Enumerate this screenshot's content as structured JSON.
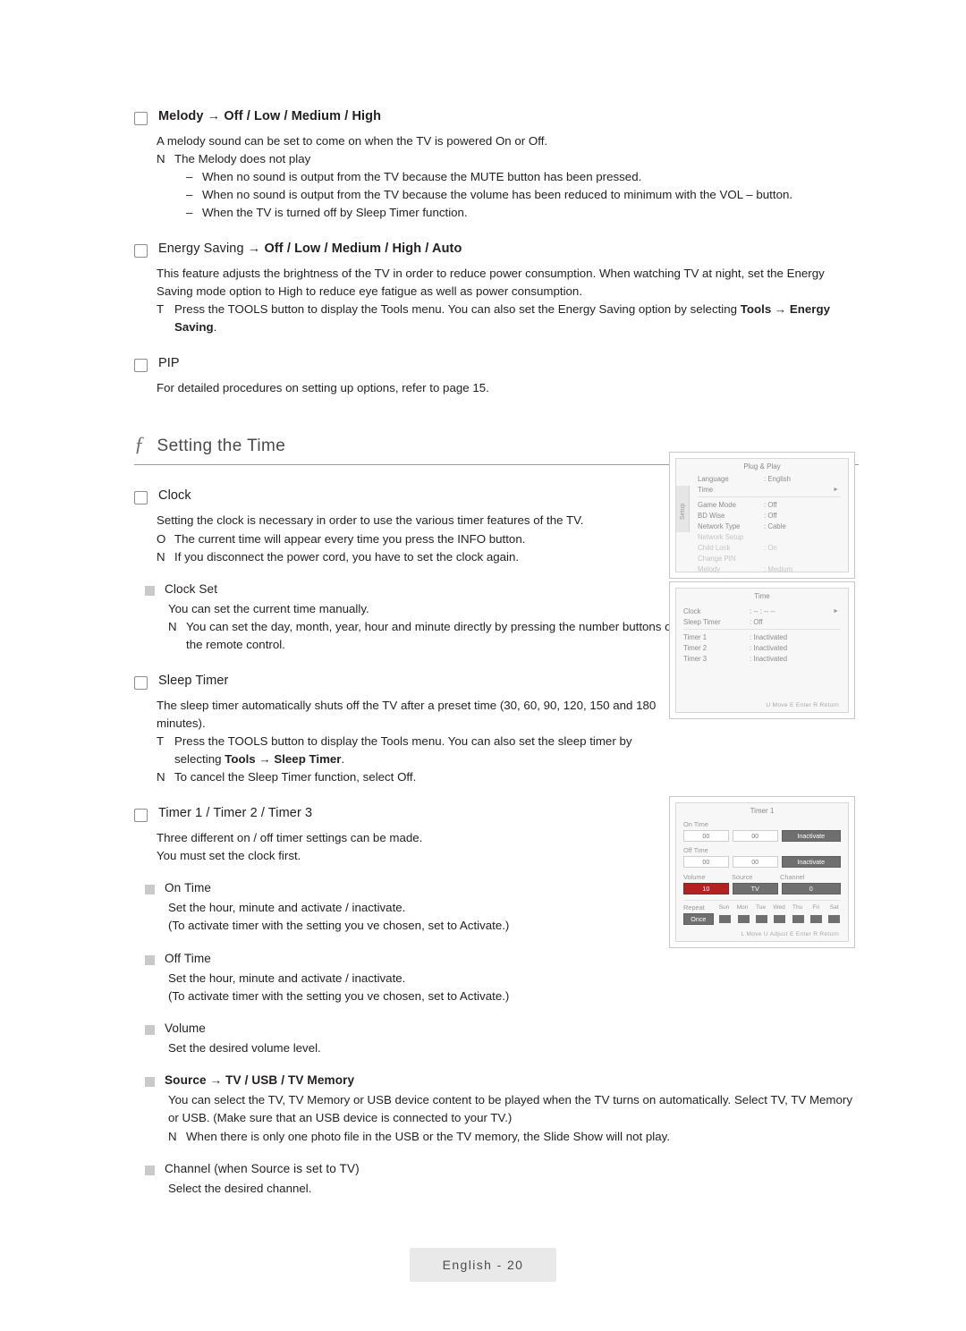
{
  "sections": {
    "melody": {
      "heading": "Melody → Off / Low / Medium / High",
      "body": "A melody sound can be set to come on when the TV is powered On or Off.",
      "note_mark": "N",
      "note": "The Melody does not play",
      "dashes": [
        "When no sound is output from the TV because the MUTE button has been pressed.",
        "When no sound is output from the TV because the volume has been reduced to minimum with the VOL – button.",
        "When the TV is turned off by Sleep Timer function."
      ],
      "dash_mark": "–"
    },
    "energy_saving": {
      "heading_plain": "Energy Saving → ",
      "heading_bold": "Off / Low / Medium / High / Auto",
      "body": "This feature adjusts the brightness of the TV in order to reduce power consumption. When watching TV at night, set the Energy Saving mode option to High to reduce eye fatigue as well as power consumption.",
      "tool_mark": "T",
      "tool_text_1": "Press the TOOLS button to display the Tools menu. You can also set the Energy Saving option by selecting ",
      "tool_bold": "Tools → Energy Saving",
      "tool_text_2": "."
    },
    "pip": {
      "heading": "PIP",
      "body": "For detailed procedures on setting up options, refer to page 15."
    },
    "chapter": {
      "glyph": "ƒ",
      "title": "Setting the Time"
    },
    "clock": {
      "heading": "Clock",
      "body": "Setting the clock is necessary in order to use the various timer features of the TV.",
      "notes": [
        {
          "mark": "O",
          "text": "The current time will appear every time you press the INFO button."
        },
        {
          "mark": "N",
          "text": "If you disconnect the power cord, you have to set the clock again."
        }
      ],
      "clock_set": {
        "heading": "Clock Set",
        "body": "You can set the current time manually.",
        "note_mark": "N",
        "note": "You can set the day, month, year, hour and minute directly by pressing the number buttons on the remote control."
      }
    },
    "sleep_timer": {
      "heading": "Sleep Timer",
      "body": "The sleep timer automatically shuts off the TV after a preset time (30, 60, 90, 120, 150 and 180 minutes).",
      "tool_mark": "T",
      "tool_text_1": "Press the TOOLS button to display the Tools menu. You can also set the sleep timer by selecting ",
      "tool_bold": "Tools → Sleep Timer",
      "tool_text_2": ".",
      "note_mark": "N",
      "note": "To cancel the Sleep Timer function, select Off."
    },
    "timers": {
      "heading": "Timer 1 / Timer 2 / Timer 3",
      "body1": "Three different on / off timer settings can be made.",
      "body2": "You must set the clock first.",
      "on_time": {
        "heading": "On Time",
        "body1": "Set the hour, minute and activate / inactivate.",
        "body2": "(To activate timer with the setting you ve chosen, set to Activate.)"
      },
      "off_time": {
        "heading": "Off Time",
        "body1": "Set the hour, minute and activate / inactivate.",
        "body2": "(To activate timer with the setting you ve chosen, set to Activate.)"
      },
      "volume": {
        "heading": "Volume",
        "body": "Set the desired volume level."
      },
      "source": {
        "heading_plain": "Source → ",
        "heading_bold": "TV / USB / TV Memory",
        "body": "You can select the TV, TV Memory or USB device content to be played when the TV turns on automatically. Select TV, TV Memory or USB. (Make sure that an USB device is connected to your TV.)",
        "note_mark": "N",
        "note": "When there is only one photo file in the USB or the TV memory, the Slide Show will not play."
      },
      "channel": {
        "heading": "Channel (when Source is set to TV)",
        "body": "Select the desired channel."
      }
    }
  },
  "osd_setup": {
    "tab_label": "Setup",
    "title": "Plug & Play",
    "rows": [
      {
        "label": "Language",
        "value": ": English",
        "state": "normal"
      },
      {
        "label": "Time",
        "value": "",
        "arrow": "►",
        "state": "normal"
      },
      {
        "label": "Game Mode",
        "value": ": Off",
        "state": "normal"
      },
      {
        "label": "BD Wise",
        "value": ": Off",
        "state": "normal"
      },
      {
        "label": "Network Type",
        "value": ": Cable",
        "state": "normal"
      },
      {
        "label": "Network Setup",
        "value": "",
        "state": "dim"
      },
      {
        "label": "Child Lock",
        "value": ": On",
        "state": "dim"
      },
      {
        "label": "Change PIN",
        "value": "",
        "state": "dim"
      },
      {
        "label": "Melody",
        "value": ": Medium",
        "state": "dim"
      }
    ]
  },
  "osd_time": {
    "title": "Time",
    "rows": [
      {
        "label": "Clock",
        "value": ": -- : -- --",
        "arrow": "►",
        "state": "normal"
      },
      {
        "label": "Sleep Timer",
        "value": ": Off",
        "state": "normal"
      },
      {
        "label": "Timer 1",
        "value": ": Inactivated",
        "state": "normal"
      },
      {
        "label": "Timer 2",
        "value": ": Inactivated",
        "state": "normal"
      },
      {
        "label": "Timer 3",
        "value": ": Inactivated",
        "state": "normal"
      }
    ],
    "footer": "U  Move    E  Enter    R  Return"
  },
  "osd_timer1": {
    "title": "Timer 1",
    "on_time_label": "On Time",
    "off_time_label": "Off Time",
    "on_hour": "00",
    "on_min": "00",
    "on_state": "Inactivate",
    "off_hour": "00",
    "off_min": "00",
    "off_state": "Inactivate",
    "volume_label": "Volume",
    "source_label": "Source",
    "channel_label": "Channel",
    "volume_value": "10",
    "source_value": "TV",
    "channel_value": "0",
    "repeat_label": "Repeat",
    "repeat_value": "Once",
    "days": [
      "Sun",
      "Mon",
      "Tue",
      "Wed",
      "Thu",
      "Fri",
      "Sat"
    ],
    "footer": "L  Move    U  Adjust    E  Enter    R  Return"
  },
  "footer": {
    "label": "English - 20"
  }
}
